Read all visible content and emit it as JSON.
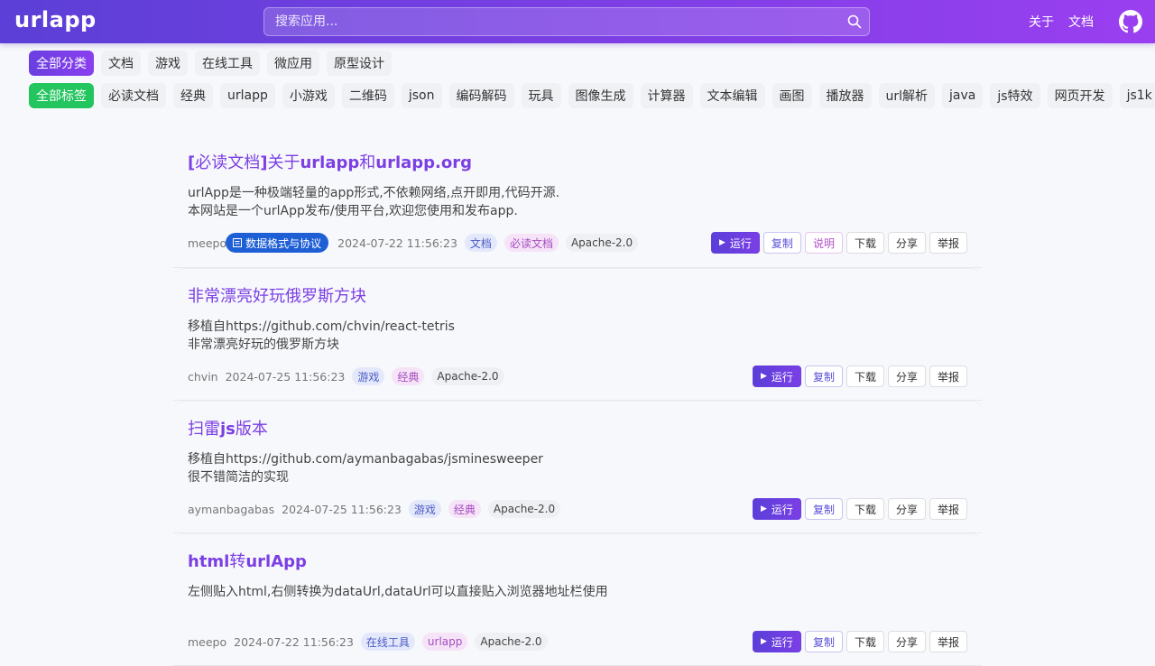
{
  "header": {
    "brand": "urlapp",
    "search_placeholder": "搜索应用...",
    "nav": [
      "关于",
      "文档"
    ]
  },
  "categories": [
    "全部分类",
    "文档",
    "游戏",
    "在线工具",
    "微应用",
    "原型设计"
  ],
  "tags": [
    "全部标签",
    "必读文档",
    "经典",
    "urlapp",
    "小游戏",
    "二维码",
    "json",
    "编码解码",
    "玩具",
    "图像生成",
    "计算器",
    "文本编辑",
    "画图",
    "播放器",
    "url解析",
    "java",
    "js特效",
    "网页开发",
    "js1k"
  ],
  "buttons": {
    "run": "运行",
    "copy": "复制",
    "help": "说明",
    "download": "下载",
    "share": "分享",
    "report": "举报"
  },
  "apps": [
    {
      "title_parts": [
        [
          "[",
          true
        ],
        [
          "必读文档",
          false
        ],
        [
          "]",
          true
        ],
        [
          "关于",
          false
        ],
        [
          "urlapp",
          true
        ],
        [
          "和",
          false
        ],
        [
          "urlapp.org",
          true
        ]
      ],
      "desc": [
        "urlApp是一种极端轻量的app形式,不依赖网络,点开即用,代码开源.",
        "本网站是一个urlApp发布/使用平台,欢迎您使用和发布app."
      ],
      "author": "meepo",
      "badge": "数据格式与协议",
      "date": "2024-07-22 11:56:23",
      "tags": [
        [
          "文档",
          "blue"
        ],
        [
          "必读文档",
          "purple"
        ],
        [
          "Apache-2.0",
          "gray"
        ]
      ],
      "has_help": true
    },
    {
      "title_parts": [
        [
          "非常漂亮好玩俄罗斯方块",
          false
        ]
      ],
      "desc": [
        "移植自https://github.com/chvin/react-tetris",
        "非常漂亮好玩的俄罗斯方块"
      ],
      "author": "chvin",
      "date": "2024-07-25 11:56:23",
      "tags": [
        [
          "游戏",
          "blue"
        ],
        [
          "经典",
          "purple"
        ],
        [
          "Apache-2.0",
          "gray"
        ]
      ],
      "has_help": false
    },
    {
      "title_parts": [
        [
          "扫雷",
          false
        ],
        [
          "js",
          true
        ],
        [
          "版本",
          false
        ]
      ],
      "desc": [
        "移植自https://github.com/aymanbagabas/jsminesweeper",
        "很不错简洁的实现"
      ],
      "author": "aymanbagabas",
      "date": "2024-07-25 11:56:23",
      "tags": [
        [
          "游戏",
          "blue"
        ],
        [
          "经典",
          "purple"
        ],
        [
          "Apache-2.0",
          "gray"
        ]
      ],
      "has_help": false
    },
    {
      "title_parts": [
        [
          "html",
          true
        ],
        [
          "转",
          false
        ],
        [
          "urlApp",
          true
        ]
      ],
      "desc": [
        "左侧贴入html,右侧转换为dataUrl,dataUrl可以直接贴入浏览器地址栏使用"
      ],
      "author": "meepo",
      "date": "2024-07-22 11:56:23",
      "tags": [
        [
          "在线工具",
          "blue"
        ],
        [
          "urlapp",
          "purple"
        ],
        [
          "Apache-2.0",
          "gray"
        ]
      ],
      "has_help": false
    }
  ]
}
